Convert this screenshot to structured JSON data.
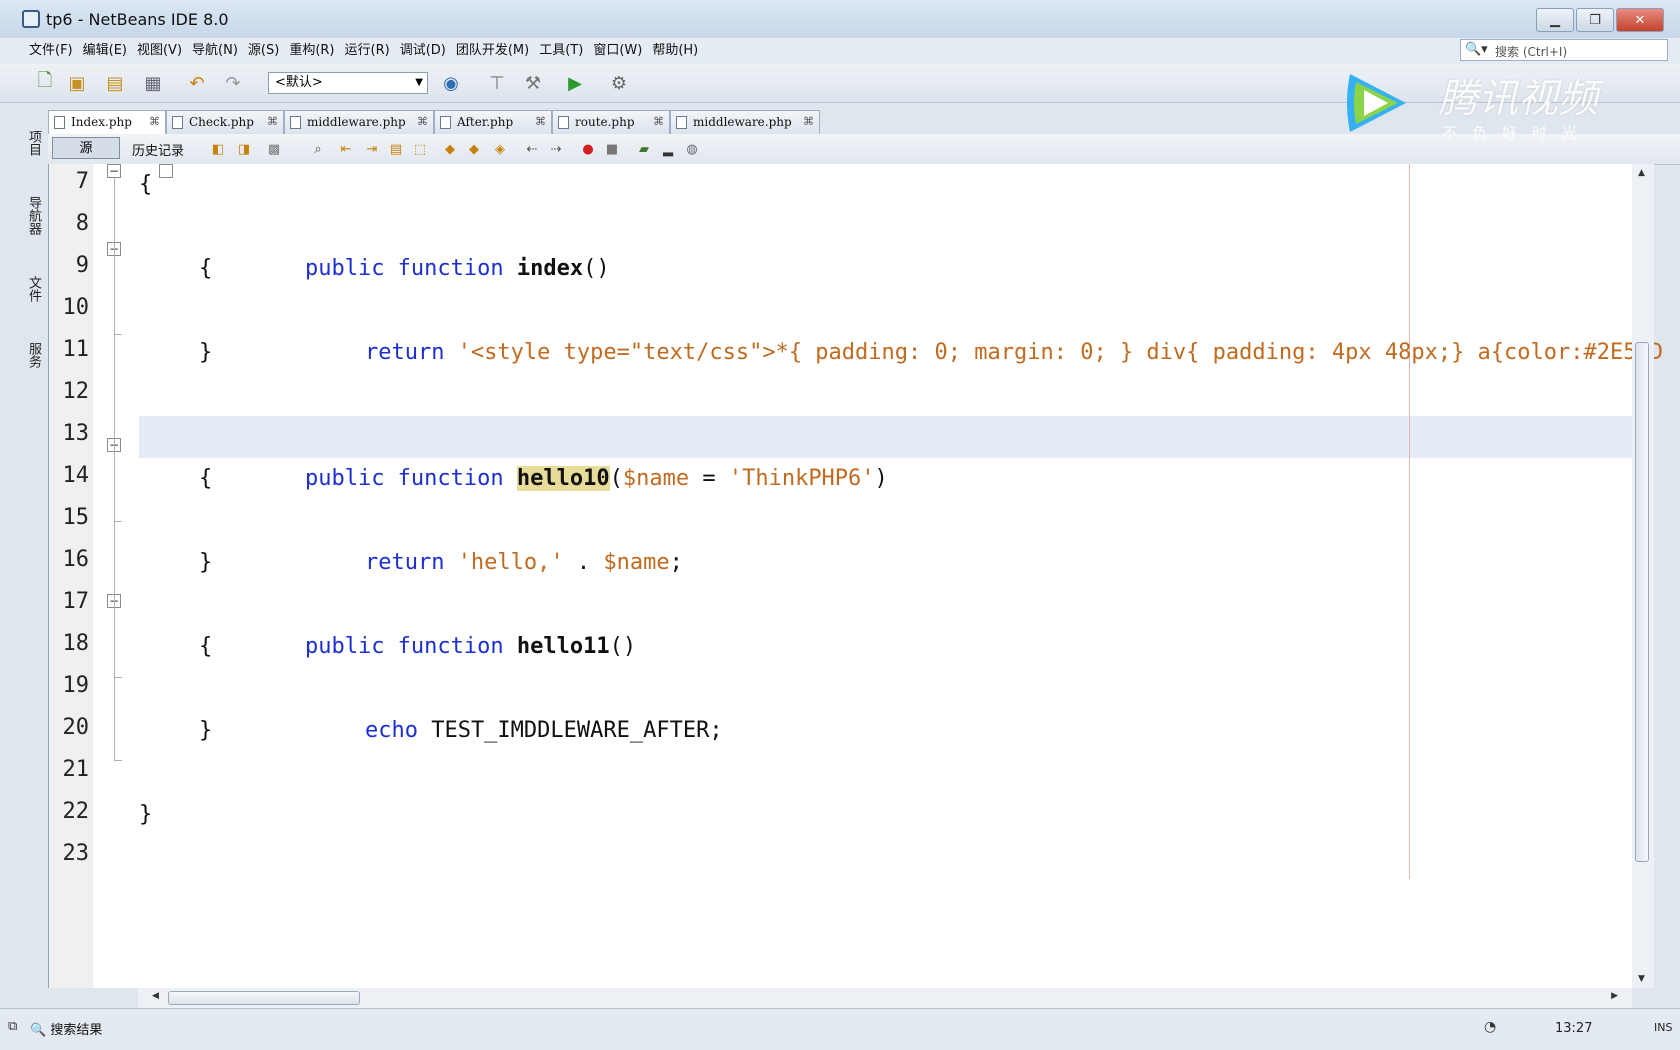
{
  "window": {
    "title": "tp6 - NetBeans IDE 8.0"
  },
  "menus": [
    "文件(F)",
    "编辑(E)",
    "视图(V)",
    "导航(N)",
    "源(S)",
    "重构(R)",
    "运行(R)",
    "调试(D)",
    "团队开发(M)",
    "工具(T)",
    "窗口(W)",
    "帮助(H)"
  ],
  "search": {
    "placeholder": "搜索 (Ctrl+I)"
  },
  "toolbar": {
    "config_value": "<默认>"
  },
  "side_panels": [
    "项目",
    "导航器",
    "文件",
    "服务"
  ],
  "tabs": [
    {
      "label": "Index.php",
      "active": true
    },
    {
      "label": "Check.php",
      "active": false
    },
    {
      "label": "middleware.php",
      "active": false
    },
    {
      "label": "After.php",
      "active": false
    },
    {
      "label": "route.php",
      "active": false
    },
    {
      "label": "middleware.php",
      "active": false
    }
  ],
  "editor_bar": {
    "source_label": "源",
    "history_label": "历史记录"
  },
  "code": {
    "current_line": 13,
    "lines": [
      {
        "n": "7",
        "text": "{"
      },
      {
        "n": "8",
        "text": "public function index()"
      },
      {
        "n": "9",
        "text": "{"
      },
      {
        "n": "10",
        "text": "return '<style type=\"text/css\">*{ padding: 0; margin: 0; } div{ padding: 4px 48px;} a{color:#2E5CD"
      },
      {
        "n": "11",
        "text": "}"
      },
      {
        "n": "12",
        "text": ""
      },
      {
        "n": "13",
        "text": "public function hello10($name = 'ThinkPHP6')"
      },
      {
        "n": "14",
        "text": "{"
      },
      {
        "n": "15",
        "text": "return 'hello,' . $name;"
      },
      {
        "n": "16",
        "text": "}"
      },
      {
        "n": "17",
        "text": "public function hello11()"
      },
      {
        "n": "18",
        "text": "{"
      },
      {
        "n": "19",
        "text": "echo TEST_IMDDLEWARE_AFTER;"
      },
      {
        "n": "20",
        "text": "}"
      },
      {
        "n": "21",
        "text": ""
      },
      {
        "n": "22",
        "text": "}"
      },
      {
        "n": "23",
        "text": ""
      }
    ]
  },
  "statusbar": {
    "search_results": "搜索结果",
    "position": "13:27",
    "mode": "INS"
  },
  "watermark": {
    "brand": "腾讯视频",
    "slogan": "不负好时光"
  },
  "colors": {
    "keyword": "#1c2fd0",
    "string": "#c26a1f",
    "highlight": "#e6ecf7",
    "selection": "#e8dc9a"
  }
}
